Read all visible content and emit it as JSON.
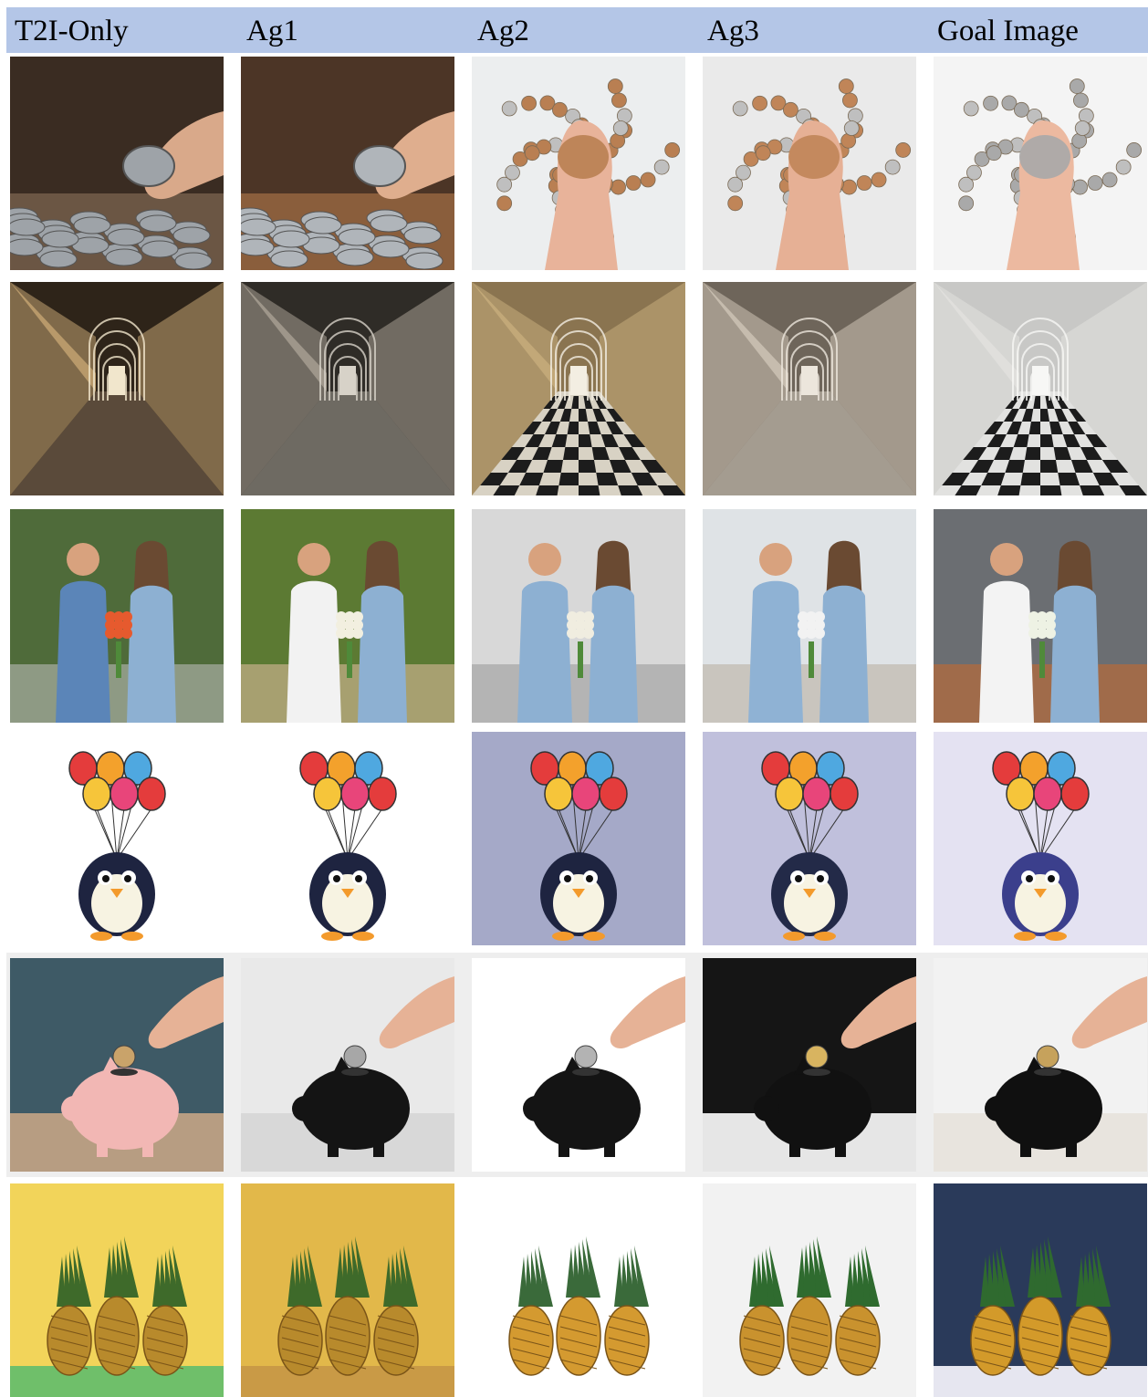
{
  "columns": [
    "T2I-Only",
    "Ag1",
    "Ag2",
    "Ag3",
    "Goal Image"
  ],
  "colors": {
    "header_bg": "#b4c6e7",
    "row_bg_gray": "#eeeeee",
    "row_bg_white": "#ffffff"
  },
  "rows": [
    {
      "id": "coins-hand",
      "cells": [
        {
          "scene": "coins",
          "bg": "#3a2c22",
          "floor": "#6b5644",
          "hand": "#d9a98a",
          "coin": "#9ea3a8"
        },
        {
          "scene": "coins",
          "bg": "#4c3526",
          "floor": "#8a5e3c",
          "hand": "#dfae8e",
          "coin": "#b0b5ba"
        },
        {
          "scene": "coins-top",
          "bg": "#eceeef",
          "floor": "#eceeef",
          "hand": "#e8b39a",
          "coin": "#b97f52"
        },
        {
          "scene": "coins-top",
          "bg": "#eaeaea",
          "floor": "#eaeaea",
          "hand": "#e6b095",
          "coin": "#c08558"
        },
        {
          "scene": "coins-top",
          "bg": "#f4f4f4",
          "floor": "#f4f4f4",
          "hand": "#ecb9a0",
          "coin": "#a9a9a9"
        }
      ]
    },
    {
      "id": "corridor",
      "cells": [
        {
          "scene": "corridor",
          "bg": "#2e2419",
          "floor": "#5a4a3a",
          "hand": "#b89a6a",
          "coin": "#f1e6cc"
        },
        {
          "scene": "corridor",
          "bg": "#2f2c27",
          "floor": "#6e6a62",
          "hand": "#9e968a",
          "coin": "#d7d2c8"
        },
        {
          "scene": "corridor-checker",
          "bg": "#8a7450",
          "floor": "#d8d2c4",
          "hand": "#c2a878",
          "coin": "#f3eee2"
        },
        {
          "scene": "corridor",
          "bg": "#6e655a",
          "floor": "#a49c90",
          "hand": "#c6bcae",
          "coin": "#ece6dc"
        },
        {
          "scene": "corridor-checker",
          "bg": "#c8c8c6",
          "floor": "#e2e2e0",
          "hand": "#e0dfdc",
          "coin": "#f7f7f5"
        }
      ]
    },
    {
      "id": "couple-flowers",
      "cells": [
        {
          "scene": "couple",
          "bg": "#4f6b3a",
          "floor": "#8e9a84",
          "hand": "#5b85b8",
          "coin": "#e65a2e"
        },
        {
          "scene": "couple",
          "bg": "#5c7a33",
          "floor": "#a7a070",
          "hand": "#f2f2f2",
          "coin": "#f2efe0"
        },
        {
          "scene": "couple",
          "bg": "#d8d8d8",
          "floor": "#b4b4b4",
          "hand": "#8db0d2",
          "coin": "#f0ede0"
        },
        {
          "scene": "couple",
          "bg": "#dfe3e6",
          "floor": "#c9c5be",
          "hand": "#8fb2d4",
          "coin": "#f2f2f2"
        },
        {
          "scene": "couple",
          "bg": "#6b6e72",
          "floor": "#a06b4a",
          "hand": "#f3f3f3",
          "coin": "#eef2e4"
        }
      ]
    },
    {
      "id": "penguin-balloons",
      "cells": [
        {
          "scene": "penguin",
          "bg": "#ffffff",
          "floor": "#ffffff",
          "hand": "#1e2440",
          "coin": "#f39a2c"
        },
        {
          "scene": "penguin",
          "bg": "#ffffff",
          "floor": "#ffffff",
          "hand": "#1e2440",
          "coin": "#e43c3c"
        },
        {
          "scene": "penguin",
          "bg": "#a5a9c8",
          "floor": "#a5a9c8",
          "hand": "#1e2440",
          "coin": "#e43c3c"
        },
        {
          "scene": "penguin",
          "bg": "#c0c0dc",
          "floor": "#c0c0dc",
          "hand": "#232a48",
          "coin": "#f0b23a"
        },
        {
          "scene": "penguin",
          "bg": "#e4e2f2",
          "floor": "#e4e2f2",
          "hand": "#3b3f8c",
          "coin": "#e8457a"
        }
      ]
    },
    {
      "id": "piggy-bank",
      "cells": [
        {
          "scene": "piggy",
          "bg": "#3e5a66",
          "floor": "#b79d82",
          "hand": "#f2b7b4",
          "coin": "#c9a36a"
        },
        {
          "scene": "piggy",
          "bg": "#e9e9e9",
          "floor": "#d8d8d8",
          "hand": "#141414",
          "coin": "#a7a7a7"
        },
        {
          "scene": "piggy",
          "bg": "#ffffff",
          "floor": "#ffffff",
          "hand": "#141414",
          "coin": "#b3b3b3"
        },
        {
          "scene": "piggy",
          "bg": "#151515",
          "floor": "#e6e6e6",
          "hand": "#111111",
          "coin": "#d8b460"
        },
        {
          "scene": "piggy",
          "bg": "#f2f2f2",
          "floor": "#e8e4de",
          "hand": "#101010",
          "coin": "#c6a25c"
        }
      ]
    },
    {
      "id": "pineapple-party",
      "cells": [
        {
          "scene": "pineapple",
          "bg": "#f2d45a",
          "floor": "#6fbf6a",
          "hand": "#b88a2c",
          "coin": "#3e6a2a"
        },
        {
          "scene": "pineapple",
          "bg": "#e2b84a",
          "floor": "#c99a46",
          "hand": "#b88a2c",
          "coin": "#3e6a2a"
        },
        {
          "scene": "pineapple",
          "bg": "#ffffff",
          "floor": "#ffffff",
          "hand": "#d49a30",
          "coin": "#3a6a3a"
        },
        {
          "scene": "pineapple",
          "bg": "#f2f2f2",
          "floor": "#f2f2f2",
          "hand": "#c9922e",
          "coin": "#2f6b2f"
        },
        {
          "scene": "pineapple",
          "bg": "#2a3a5a",
          "floor": "#e6e6f0",
          "hand": "#d39a2a",
          "coin": "#2f6a2f"
        }
      ]
    }
  ]
}
